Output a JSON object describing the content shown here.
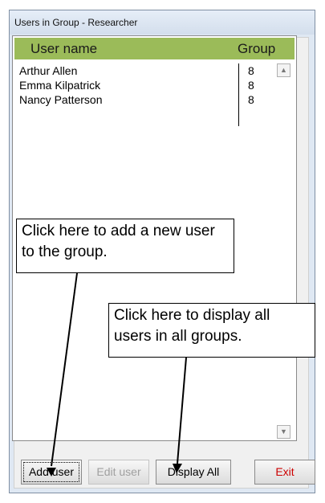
{
  "window": {
    "title": "Users in Group - Researcher"
  },
  "list": {
    "columns": [
      "User name",
      "Group"
    ],
    "rows": [
      {
        "name": "Arthur Allen",
        "group": "8"
      },
      {
        "name": "Emma Kilpatrick",
        "group": "8"
      },
      {
        "name": "Nancy Patterson",
        "group": "8"
      }
    ]
  },
  "buttons": {
    "add_user": "Add user",
    "edit_user": "Edit user",
    "display_all": "Display All",
    "exit": "Exit"
  },
  "callouts": {
    "add": "Click here to add a new user to the group.",
    "display": "Click here to display all users in all groups."
  },
  "colors": {
    "header": "#9bbb59",
    "exit_text": "#cc0000"
  },
  "icons": [
    "scroll-up-arrow-icon",
    "scroll-down-arrow-icon"
  ]
}
